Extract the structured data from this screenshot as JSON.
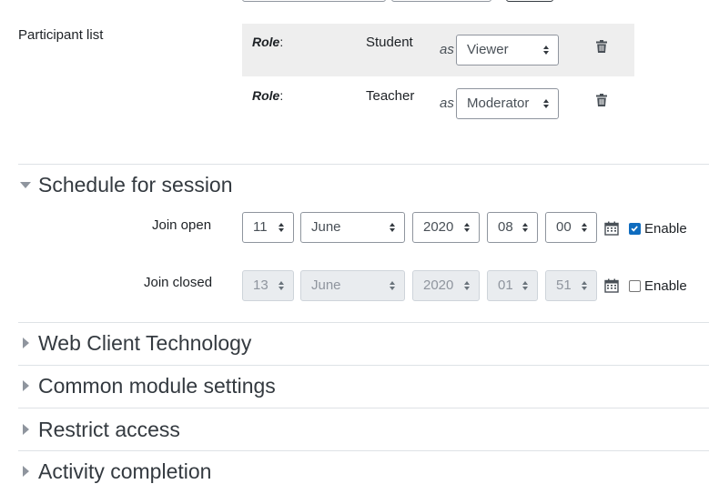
{
  "participants": {
    "label": "Participant list",
    "rows": [
      {
        "role_label": "Role",
        "name": "Student",
        "as_label": "as",
        "role_value": "Viewer"
      },
      {
        "role_label": "Role",
        "name": "Teacher",
        "as_label": "as",
        "role_value": "Moderator"
      }
    ]
  },
  "schedule": {
    "title": "Schedule for session",
    "join_open": {
      "label": "Join open",
      "day": "11",
      "month": "June",
      "year": "2020",
      "hour": "08",
      "minute": "00",
      "enable_label": "Enable",
      "enabled": true
    },
    "join_closed": {
      "label": "Join closed",
      "day": "13",
      "month": "June",
      "year": "2020",
      "hour": "01",
      "minute": "51",
      "enable_label": "Enable",
      "enabled": false
    }
  },
  "sections": {
    "web_client": "Web Client Technology",
    "common_module": "Common module settings",
    "restrict_access": "Restrict access",
    "activity_completion": "Activity completion"
  },
  "colors": {
    "accent": "#0f6cbf",
    "shaded_row": "#eeeeee",
    "section_text": "#343a40"
  }
}
